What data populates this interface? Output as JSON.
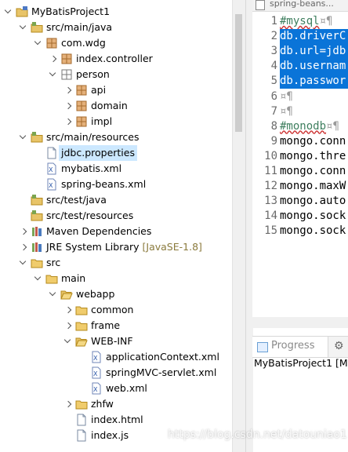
{
  "tree": [
    {
      "label": "MyBatisProject1",
      "depth": 0,
      "tw": "down",
      "icon": "project"
    },
    {
      "label": "src/main/java",
      "depth": 1,
      "tw": "down",
      "icon": "srcfolder"
    },
    {
      "label": "com.wdg",
      "depth": 2,
      "tw": "down",
      "icon": "package"
    },
    {
      "label": "index.controller",
      "depth": 3,
      "tw": "right",
      "icon": "package"
    },
    {
      "label": "person",
      "depth": 3,
      "tw": "down",
      "icon": "package-empty"
    },
    {
      "label": "api",
      "depth": 4,
      "tw": "right",
      "icon": "package"
    },
    {
      "label": "domain",
      "depth": 4,
      "tw": "right",
      "icon": "package"
    },
    {
      "label": "impl",
      "depth": 4,
      "tw": "right",
      "icon": "package"
    },
    {
      "label": "src/main/resources",
      "depth": 1,
      "tw": "down",
      "icon": "srcfolder"
    },
    {
      "label": "jdbc.properties",
      "depth": 2,
      "tw": "none",
      "icon": "file",
      "selected": true
    },
    {
      "label": "mybatis.xml",
      "depth": 2,
      "tw": "none",
      "icon": "xml"
    },
    {
      "label": "spring-beans.xml",
      "depth": 2,
      "tw": "none",
      "icon": "xml"
    },
    {
      "label": "src/test/java",
      "depth": 1,
      "tw": "none",
      "icon": "srcfolder"
    },
    {
      "label": "src/test/resources",
      "depth": 1,
      "tw": "none",
      "icon": "srcfolder"
    },
    {
      "label": "Maven Dependencies",
      "depth": 1,
      "tw": "right",
      "icon": "library"
    },
    {
      "label": "JRE System Library",
      "deco": "[JavaSE-1.8]",
      "depth": 1,
      "tw": "right",
      "icon": "library"
    },
    {
      "label": "src",
      "depth": 1,
      "tw": "down",
      "icon": "folder"
    },
    {
      "label": "main",
      "depth": 2,
      "tw": "down",
      "icon": "folder"
    },
    {
      "label": "webapp",
      "depth": 3,
      "tw": "down",
      "icon": "folder-open"
    },
    {
      "label": "common",
      "depth": 4,
      "tw": "right",
      "icon": "folder"
    },
    {
      "label": "frame",
      "depth": 4,
      "tw": "right",
      "icon": "folder"
    },
    {
      "label": "WEB-INF",
      "depth": 4,
      "tw": "down",
      "icon": "folder-open"
    },
    {
      "label": "applicationContext.xml",
      "depth": 5,
      "tw": "none",
      "icon": "xml"
    },
    {
      "label": "springMVC-servlet.xml",
      "depth": 5,
      "tw": "none",
      "icon": "xml"
    },
    {
      "label": "web.xml",
      "depth": 5,
      "tw": "none",
      "icon": "xml"
    },
    {
      "label": "zhfw",
      "depth": 4,
      "tw": "right",
      "icon": "folder"
    },
    {
      "label": "index.html",
      "depth": 4,
      "tw": "none",
      "icon": "file"
    },
    {
      "label": "index.js",
      "depth": 4,
      "tw": "none",
      "icon": "file"
    }
  ],
  "editor": {
    "tab_label": "spring-beans...",
    "lines": [
      {
        "n": "1",
        "text": "#mysql",
        "pilcrow": "¤¶",
        "style": "cm",
        "squiggle": true
      },
      {
        "n": "2",
        "text": "db.driverC",
        "style": "sel"
      },
      {
        "n": "3",
        "text": "db.url=jdb",
        "style": "sel"
      },
      {
        "n": "4",
        "text": "db.usernam",
        "style": "sel"
      },
      {
        "n": "5",
        "text": "db.passwor",
        "style": "sel"
      },
      {
        "n": "6",
        "text": "",
        "pilcrow": "¤¶",
        "style": "plain"
      },
      {
        "n": "7",
        "text": "",
        "pilcrow": "¤¶",
        "style": "plain"
      },
      {
        "n": "8",
        "text": "#monodb",
        "pilcrow": "¤¶",
        "style": "cm",
        "squiggle": true
      },
      {
        "n": "9",
        "text": "mongo.conn",
        "style": "plain"
      },
      {
        "n": "10",
        "text": "mongo.thre",
        "style": "plain"
      },
      {
        "n": "11",
        "text": "mongo.conn",
        "style": "plain"
      },
      {
        "n": "12",
        "text": "mongo.maxW",
        "style": "plain"
      },
      {
        "n": "13",
        "text": "mongo.auto",
        "style": "plain"
      },
      {
        "n": "14",
        "text": "mongo.sock",
        "style": "plain"
      },
      {
        "n": "15",
        "text": "mongo.sock",
        "style": "plain"
      }
    ]
  },
  "progress_view": {
    "tab_label": "Progress",
    "content": "MyBatisProject1 [Ma"
  },
  "watermark": "https://blog.csdn.net/datouniao1"
}
